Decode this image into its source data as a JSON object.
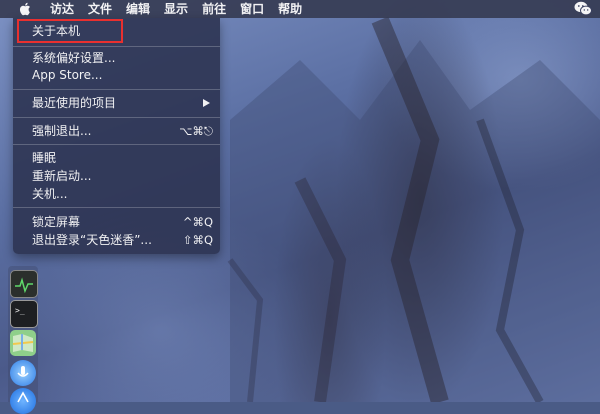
{
  "menubar": {
    "apple_icon": "apple-icon",
    "items": [
      "访达",
      "文件",
      "编辑",
      "显示",
      "前往",
      "窗口",
      "帮助"
    ],
    "right_icon": "wechat-icon"
  },
  "apple_menu": {
    "items": [
      {
        "label": "关于本机",
        "shortcut": ""
      },
      {
        "label": "系统偏好设置...",
        "shortcut": ""
      },
      {
        "label": "App Store...",
        "shortcut": ""
      },
      {
        "label": "最近使用的项目",
        "shortcut": ""
      },
      {
        "label": "强制退出...",
        "shortcut": "⌥⌘⎋"
      },
      {
        "label": "睡眠",
        "shortcut": ""
      },
      {
        "label": "重新启动...",
        "shortcut": ""
      },
      {
        "label": "关机...",
        "shortcut": ""
      },
      {
        "label": "锁定屏幕",
        "shortcut": "^⌘Q"
      },
      {
        "label": "退出登录“天色迷香”...",
        "shortcut": "⇧⌘Q"
      }
    ],
    "highlight_color": "#e8302f"
  },
  "dock": {
    "icons": [
      "activity-monitor-icon",
      "terminal-icon",
      "maps-icon",
      "siri-icon",
      "app-store-icon"
    ]
  }
}
